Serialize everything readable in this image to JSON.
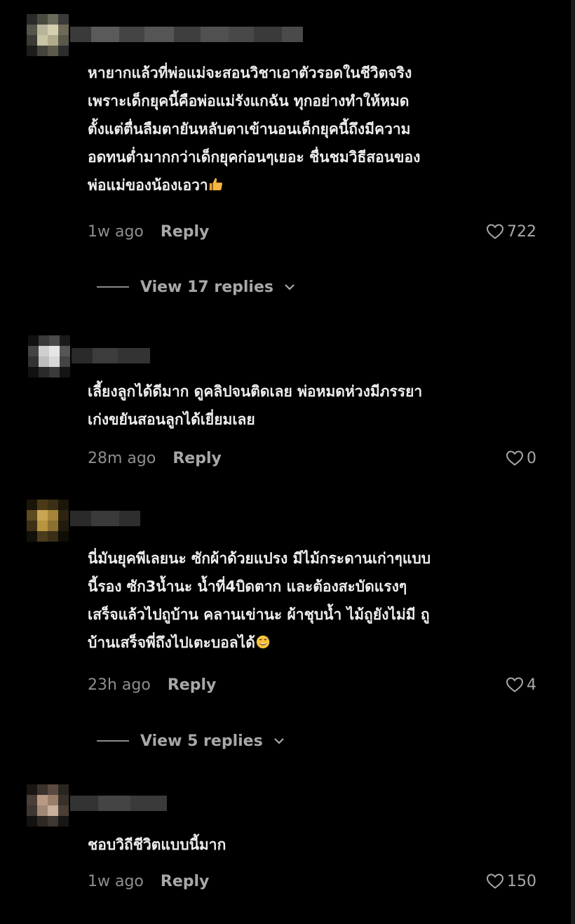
{
  "comments": [
    {
      "text": "หายากแล้วที่พ่อแม่จะสอนวิชาเอาตัวรอดในชีวิตจริง\nเพราะเด็กยุคนี้คือพ่อแม่รังแกฉัน ทุกอย่างทำให้หมด\nตั้งแต่ตื่นลืมตายันหลับตาเข้านอนเด็กยุคนี้ถึงมีความ\nอดทนต่ำมากกว่าเด็กยุคก่อนๆเยอะ ชื่นชมวิธีสอนของ\nพ่อแม่ของน้องเอวา",
      "emoji": "thumbs-up-emoji",
      "time": "1w ago",
      "reply_label": "Reply",
      "likes": "722",
      "view_replies": "View 17 replies"
    },
    {
      "text": "เลี้ยงลูกได้ดีมาก ดูคลิปจนติดเลย พ่อหมดห่วงมีภรรยา\nเก่งขยันสอนลูกได้เยี่ยมเลย",
      "time": "28m ago",
      "reply_label": "Reply",
      "likes": "0"
    },
    {
      "text": "นี่มันยุคพีเลยนะ ซักผ้าด้วยแปรง มีไม้กระดานเก่าๆแบบ\nนี้รอง ซัก3น้ำนะ น้ำที่4บิดตาก และต้องสะบัดแรงๆ\nเสร็จแล้วไปถูบ้าน คลานเข่านะ ผ้าชุบน้ำ ไม้ถูยังไม่มี ถู\nบ้านเสร็จพี่ถึงไปเตะบอลได้",
      "emoji": "smiling-face-with-sweat-emoji",
      "time": "23h ago",
      "reply_label": "Reply",
      "likes": "4",
      "view_replies": "View 5 replies"
    },
    {
      "text": "ชอบวิถีชีวิตแบบนี้มาก",
      "time": "1w ago",
      "reply_label": "Reply",
      "likes": "150"
    }
  ],
  "colors": {
    "background": "#000000",
    "text": "#ededed",
    "muted": "#8e8e8e"
  }
}
